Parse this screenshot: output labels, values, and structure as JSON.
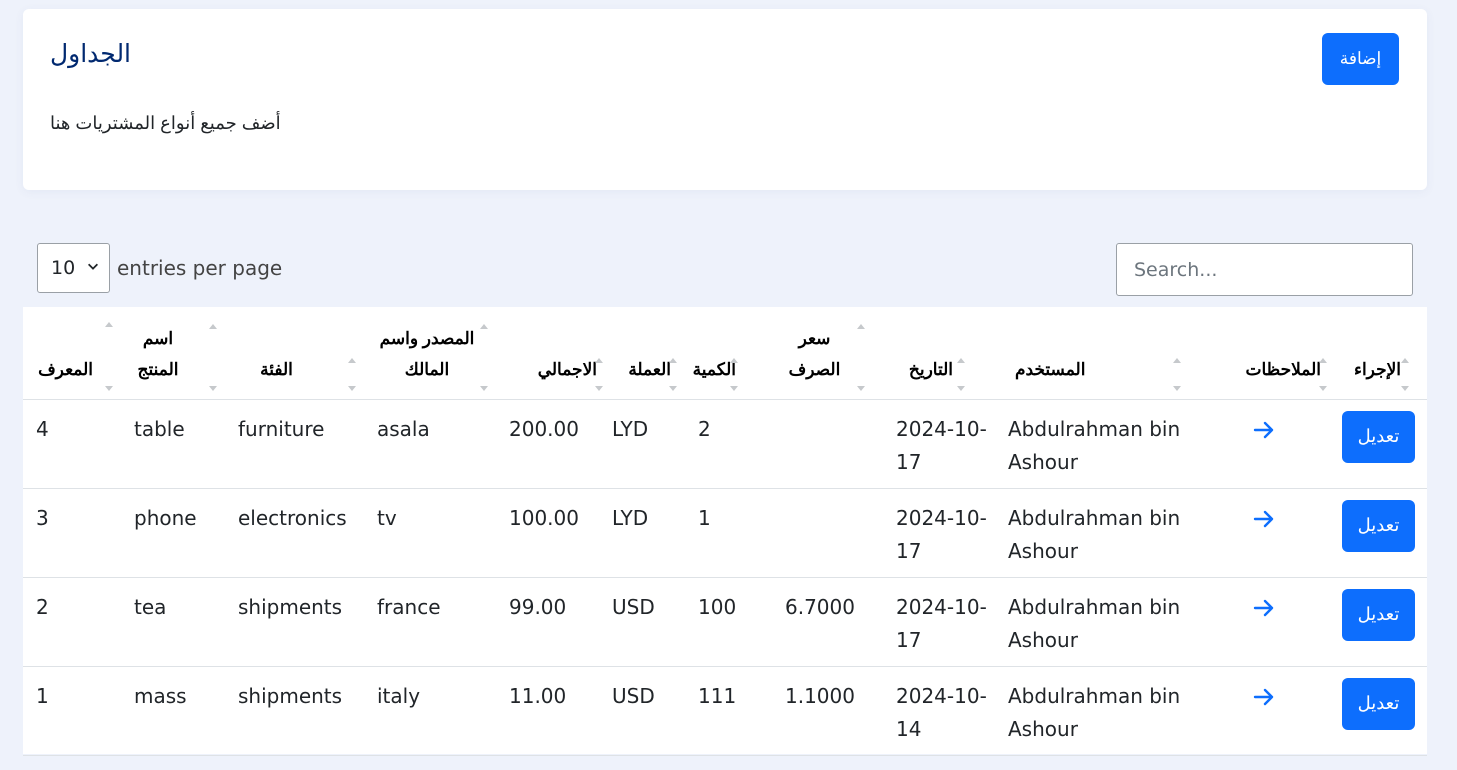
{
  "header": {
    "title": "الجداول",
    "subtitle": "أضف جميع أنواع المشتريات هنا",
    "add_label": "إضافة"
  },
  "controls": {
    "entries_value": "10",
    "entries_label": "entries per page",
    "search_placeholder": "Search..."
  },
  "table": {
    "columns": [
      {
        "key": "id",
        "label": "المعرف"
      },
      {
        "key": "product",
        "label": "اسم المنتج"
      },
      {
        "key": "category",
        "label": "الفئة"
      },
      {
        "key": "source",
        "label": "المصدر واسم المالك"
      },
      {
        "key": "total",
        "label": "الاجمالي"
      },
      {
        "key": "currency",
        "label": "العملة"
      },
      {
        "key": "quantity",
        "label": "الكمية"
      },
      {
        "key": "rate",
        "label": "سعر الصرف"
      },
      {
        "key": "date",
        "label": "التاريخ"
      },
      {
        "key": "user",
        "label": "المستخدم"
      },
      {
        "key": "notes",
        "label": "الملاحظات"
      },
      {
        "key": "action",
        "label": "الإجراء"
      }
    ],
    "rows": [
      {
        "id": "4",
        "product": "table",
        "category": "furniture",
        "source": "asala",
        "total": "200.00",
        "currency": "LYD",
        "quantity": "2",
        "rate": "",
        "date": "2024-10-17",
        "user": "Abdulrahman bin Ashour",
        "action": "تعديل"
      },
      {
        "id": "3",
        "product": "phone",
        "category": "electronics",
        "source": "tv",
        "total": "100.00",
        "currency": "LYD",
        "quantity": "1",
        "rate": "",
        "date": "2024-10-17",
        "user": "Abdulrahman bin Ashour",
        "action": "تعديل"
      },
      {
        "id": "2",
        "product": "tea",
        "category": "shipments",
        "source": "france",
        "total": "99.00",
        "currency": "USD",
        "quantity": "100",
        "rate": "6.7000",
        "date": "2024-10-17",
        "user": "Abdulrahman bin Ashour",
        "action": "تعديل"
      },
      {
        "id": "1",
        "product": "mass",
        "category": "shipments",
        "source": "italy",
        "total": "11.00",
        "currency": "USD",
        "quantity": "111",
        "rate": "1.1000",
        "date": "2024-10-14",
        "user": "Abdulrahman bin Ashour",
        "action": "تعديل"
      }
    ]
  },
  "icons": {
    "notes": "arrow-right-icon",
    "sort": "sort-icon"
  },
  "colors": {
    "primary": "#0d6efd",
    "title": "#012970",
    "background": "#eef2fb"
  }
}
